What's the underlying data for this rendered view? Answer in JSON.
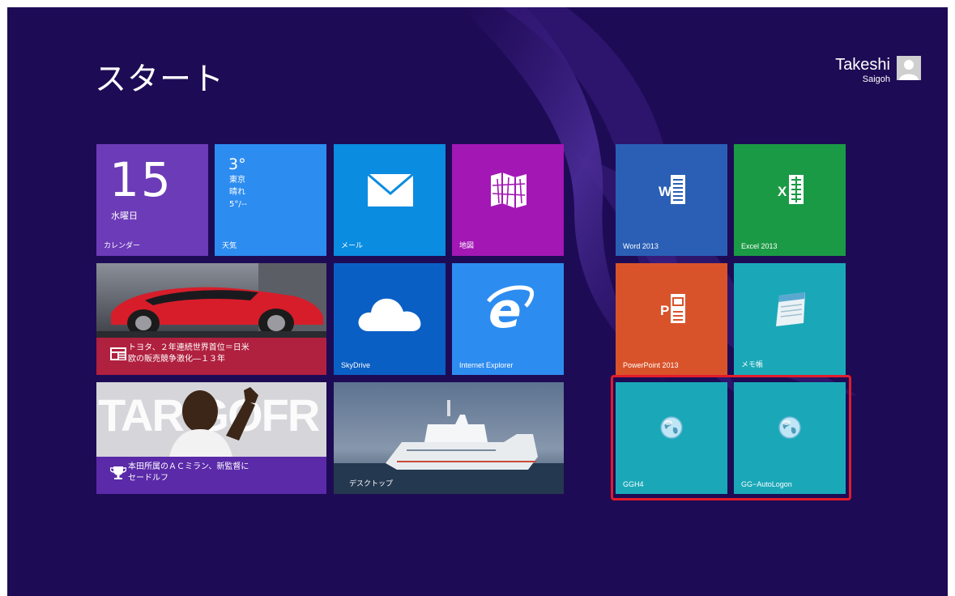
{
  "start": {
    "title": "スタート"
  },
  "user": {
    "first_name": "Takeshi",
    "last_name": "Saigoh"
  },
  "tiles": {
    "calendar": {
      "day": "15",
      "weekday": "水曜日",
      "label": "カレンダー"
    },
    "weather": {
      "temp": "3°",
      "city": "東京",
      "condition": "晴れ",
      "range": "5°/--",
      "label": "天気"
    },
    "mail": {
      "label": "メール"
    },
    "maps": {
      "label": "地図"
    },
    "word": {
      "label": "Word 2013"
    },
    "excel": {
      "label": "Excel 2013"
    },
    "news": {
      "line1": "トヨタ、２年連続世界首位＝日米",
      "line2": "欧の販売競争激化―１３年"
    },
    "skydrive": {
      "label": "SkyDrive"
    },
    "ie": {
      "label": "Internet Explorer"
    },
    "powerpoint": {
      "label": "PowerPoint 2013"
    },
    "notepad": {
      "label": "メモ帳"
    },
    "sports": {
      "line1": "本田所属のＡＣミラン、新監督に",
      "line2": "セードルフ",
      "bg_text": "TAR GOFR"
    },
    "desktop": {
      "label": "デスクトップ"
    },
    "ggh4": {
      "label": "GGH4"
    },
    "gg_autologon": {
      "label": "GG−AutoLogon"
    }
  },
  "colors": {
    "background": "#1e0b55",
    "calendar": "#6c3bb8",
    "weather": "#2d8cf0",
    "mail": "#0a8ce0",
    "maps": "#a317b5",
    "word": "#2a5fb5",
    "excel": "#1b9a45",
    "skydrive": "#0a5fc4",
    "ie": "#2d8cf0",
    "powerpoint": "#d9532a",
    "notepad": "#1aa8b8",
    "globe_tiles": "#1aa8b8",
    "news_strip": "#b0203f",
    "sports_strip": "#5a2aa8",
    "selection": "#e21b2a"
  },
  "icons": {
    "mail": "envelope-icon",
    "maps": "folded-map-icon",
    "word": "word-doc-icon",
    "excel": "excel-sheet-icon",
    "skydrive": "cloud-icon",
    "ie": "internet-explorer-e-icon",
    "powerpoint": "powerpoint-slide-icon",
    "notepad": "notepad-icon",
    "globe": "globe-icon",
    "news": "newspaper-icon",
    "sports": "trophy-icon",
    "user": "user-avatar-icon"
  }
}
